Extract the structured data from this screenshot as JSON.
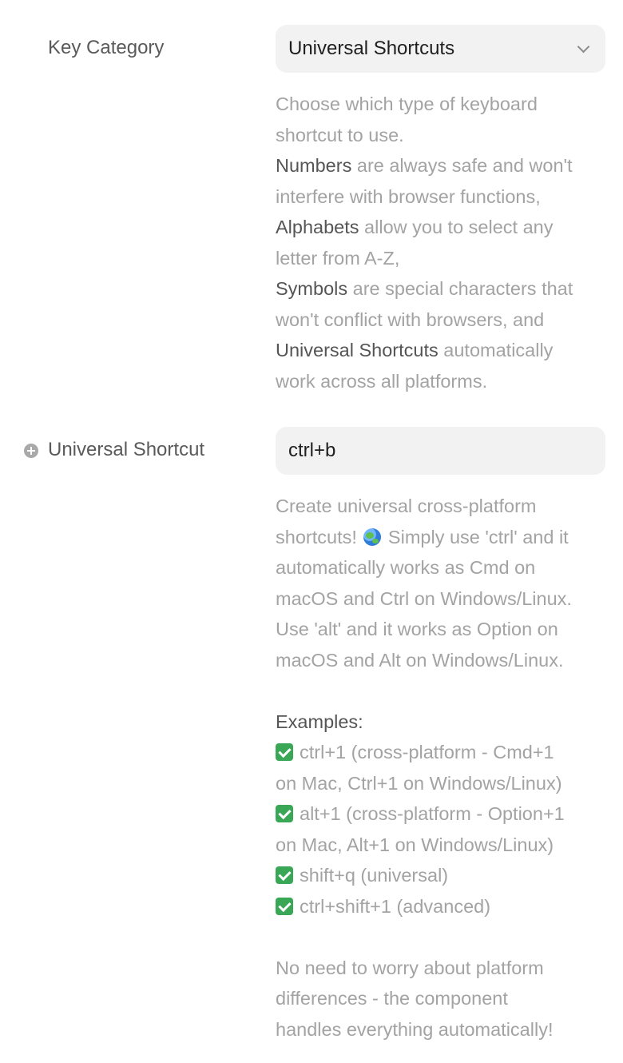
{
  "key_category": {
    "label": "Key Category",
    "selected_value": "Universal Shortcuts",
    "description": {
      "line1": "Choose which type of keyboard",
      "line2": "shortcut to use.",
      "numbers_term": "Numbers",
      "numbers_rest": " are always safe and won't",
      "line4": "interfere with browser functions,",
      "alphabets_term": "Alphabets",
      "alphabets_rest": " allow you to select any",
      "line6": "letter from A-Z,",
      "symbols_term": "Symbols",
      "symbols_rest": " are special characters that",
      "line8": "won't conflict with browsers, and",
      "universal_term": "Universal Shortcuts",
      "universal_rest": " automatically",
      "line10": "work across all platforms."
    }
  },
  "universal_shortcut": {
    "label": "Universal Shortcut",
    "value": "ctrl+b",
    "description": {
      "line1": "Create universal cross-platform",
      "line2a": "shortcuts! ",
      "line2b": " Simply use 'ctrl' and it",
      "line3": "automatically works as Cmd on",
      "line4": "macOS and Ctrl on Windows/Linux.",
      "line5": "Use 'alt' and it works as Option on",
      "line6": "macOS and Alt on Windows/Linux.",
      "examples_heading": "Examples:",
      "ex1a": "ctrl+1 (cross-platform - Cmd+1",
      "ex1b": "on Mac, Ctrl+1 on Windows/Linux)",
      "ex2a": "alt+1 (cross-platform - Option+1",
      "ex2b": "on Mac, Alt+1 on Windows/Linux)",
      "ex3": "shift+q (universal)",
      "ex4": "ctrl+shift+1 (advanced)",
      "footer1": "No need to worry about platform",
      "footer2": "differences - the component",
      "footer3": "handles everything automatically!"
    }
  }
}
